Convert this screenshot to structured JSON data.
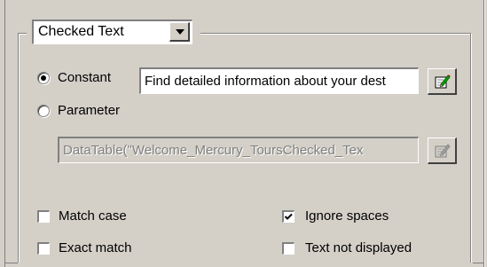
{
  "property": {
    "selected": "Checked Text"
  },
  "value_source": {
    "constant_label": "Constant",
    "constant_selected": true,
    "constant_value": "Find detailed information about your dest",
    "parameter_label": "Parameter",
    "parameter_selected": false,
    "parameter_value": "DataTable(\"Welcome_Mercury_ToursChecked_Tex"
  },
  "options": {
    "match_case": {
      "label": "Match case",
      "checked": false
    },
    "exact_match": {
      "label": "Exact match",
      "checked": false
    },
    "ignore_spaces": {
      "label": "Ignore spaces",
      "checked": true
    },
    "text_not_displayed": {
      "label": "Text not displayed",
      "checked": false
    }
  },
  "icons": {
    "constant_edit": "edit-pencil-icon",
    "parameter_edit": "edit-pencil-icon",
    "combo_arrow": "chevron-down-icon"
  },
  "colors": {
    "background": "#d4d0c8",
    "disabled_text": "#808080"
  }
}
